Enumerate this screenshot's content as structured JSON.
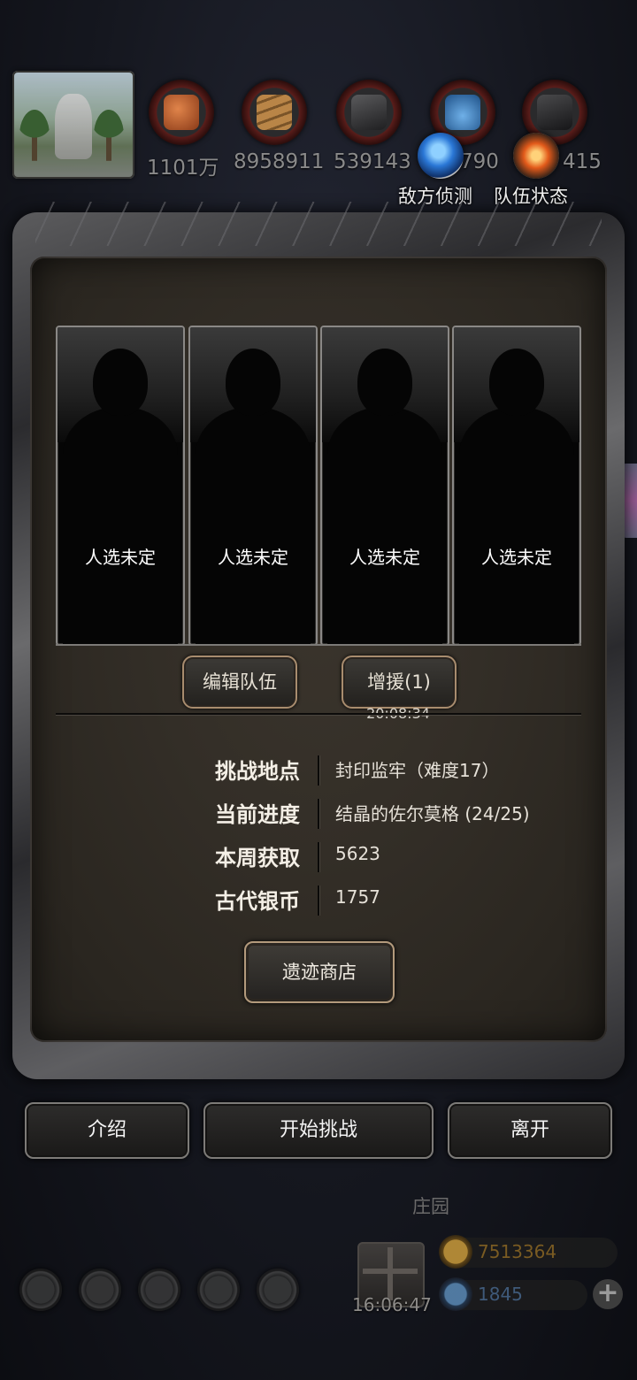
{
  "resources": [
    {
      "name": "meat-icon",
      "value": "1101万",
      "color": "#b4562a"
    },
    {
      "name": "wood-icon",
      "value": "8958911",
      "color": "#9a6a36"
    },
    {
      "name": "iron-icon",
      "value": "539143",
      "color": "#3b3b3d"
    },
    {
      "name": "crystal-icon",
      "value": "790",
      "color": "#3f7fb8"
    },
    {
      "name": "stone-icon",
      "value": "415",
      "color": "#2f2f31"
    }
  ],
  "top_buttons": {
    "scout_label": "敌方侦测",
    "status_label": "队伍状态"
  },
  "slots": [
    {
      "label": "人选未定"
    },
    {
      "label": "人选未定"
    },
    {
      "label": "人选未定"
    },
    {
      "label": "人选未定"
    }
  ],
  "team": {
    "edit_label": "编辑队伍",
    "reinforce_label": "增援(1)",
    "reinforce_timer": "20:08:34"
  },
  "info": {
    "location_key": "挑战地点",
    "location_val": "封印监牢（难度17）",
    "progress_key": "当前进度",
    "progress_val": "结晶的佐尔莫格 (24/25)",
    "weekly_key": "本周获取",
    "weekly_val": "5623",
    "coin_key": "古代银币",
    "coin_val": "1757"
  },
  "shop_label": "遗迹商店",
  "actions": {
    "intro_label": "介绍",
    "start_label": "开始挑战",
    "leave_label": "离开"
  },
  "hud": {
    "estate_label": "庄园",
    "gift_timer": "16:06:47",
    "gold_value": "7513364",
    "gem_value": "1845",
    "plus_label": "+"
  }
}
